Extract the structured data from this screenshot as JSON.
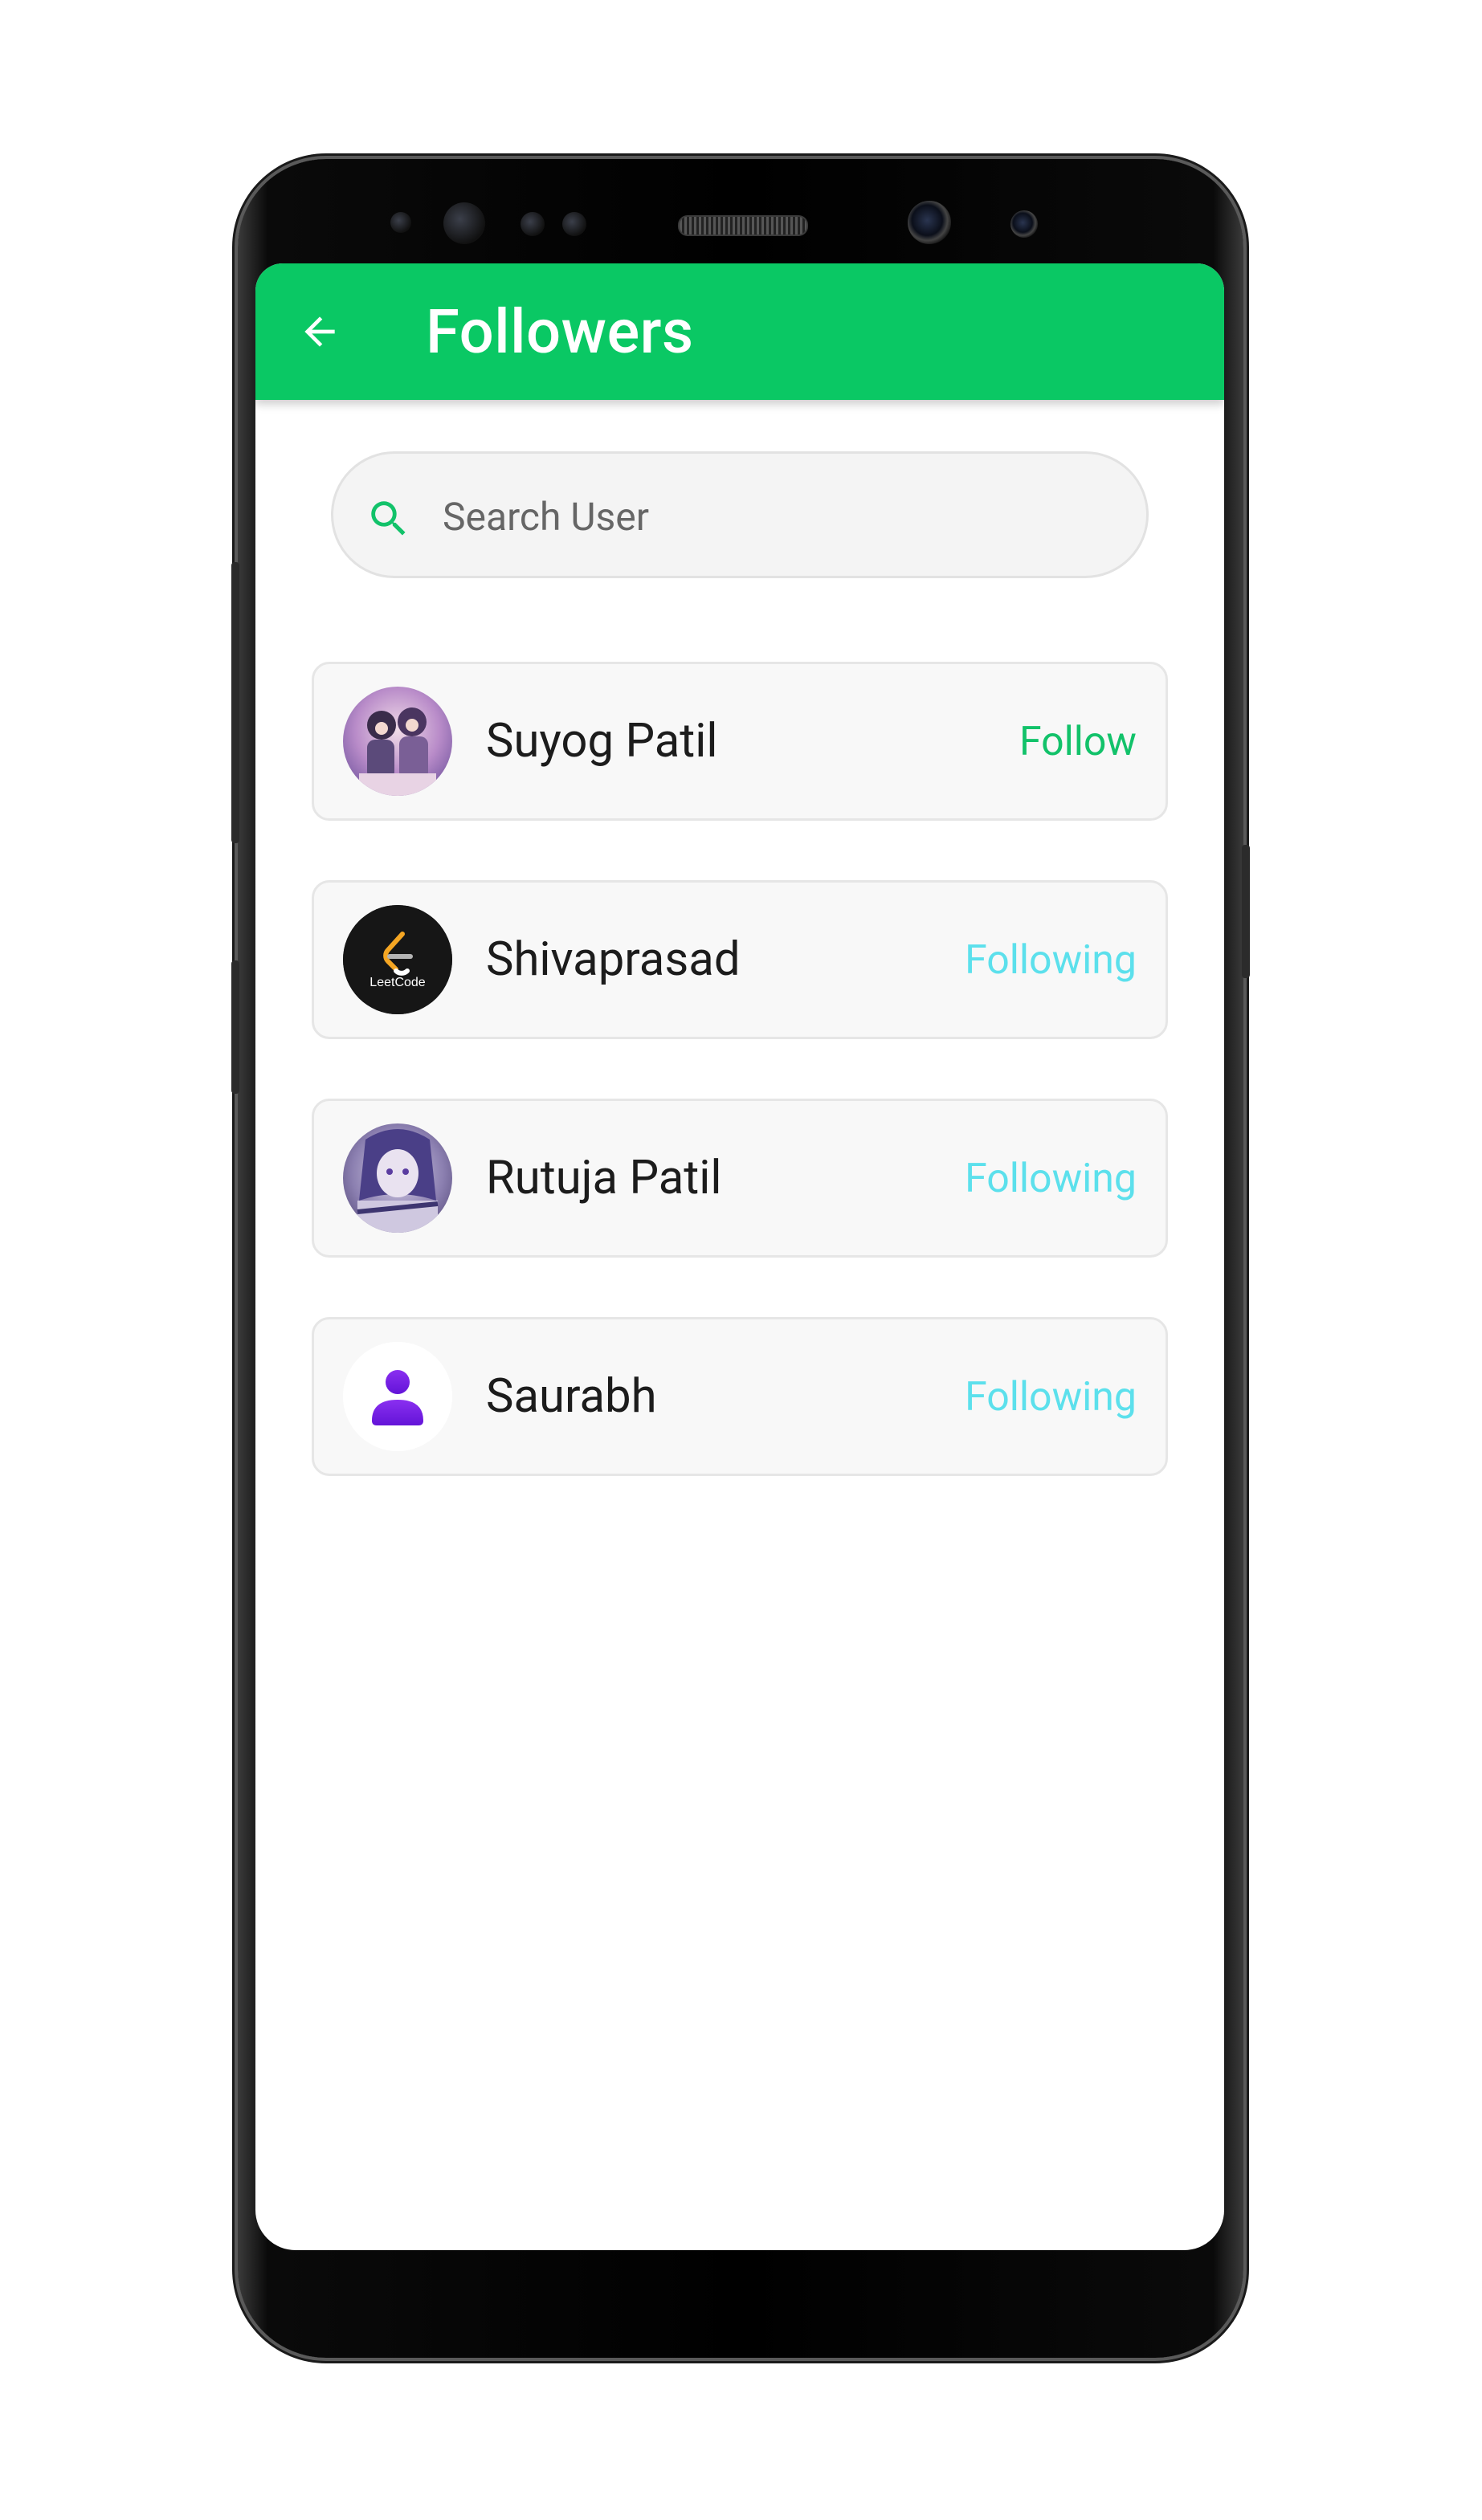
{
  "app": {
    "title": "Followers",
    "accent_color": "#0ac864"
  },
  "header": {
    "back_icon": "arrow-left-icon",
    "title": "Followers"
  },
  "search": {
    "icon": "search-icon",
    "placeholder": "Search User",
    "value": ""
  },
  "users": [
    {
      "name": "Suyog Patil",
      "action": "Follow",
      "action_color": "#12c26a",
      "avatar": "anime-avatar"
    },
    {
      "name": "Shivaprasad",
      "action": "Following",
      "action_color": "#5ce0ec",
      "avatar": "leetcode-logo",
      "avatar_text": "LeetCode"
    },
    {
      "name": "Rutuja Patil",
      "action": "Following",
      "action_color": "#5ce0ec",
      "avatar": "anime-girl-avatar"
    },
    {
      "name": "Saurabh",
      "action": "Following",
      "action_color": "#5ce0ec",
      "avatar": "person-icon"
    }
  ]
}
